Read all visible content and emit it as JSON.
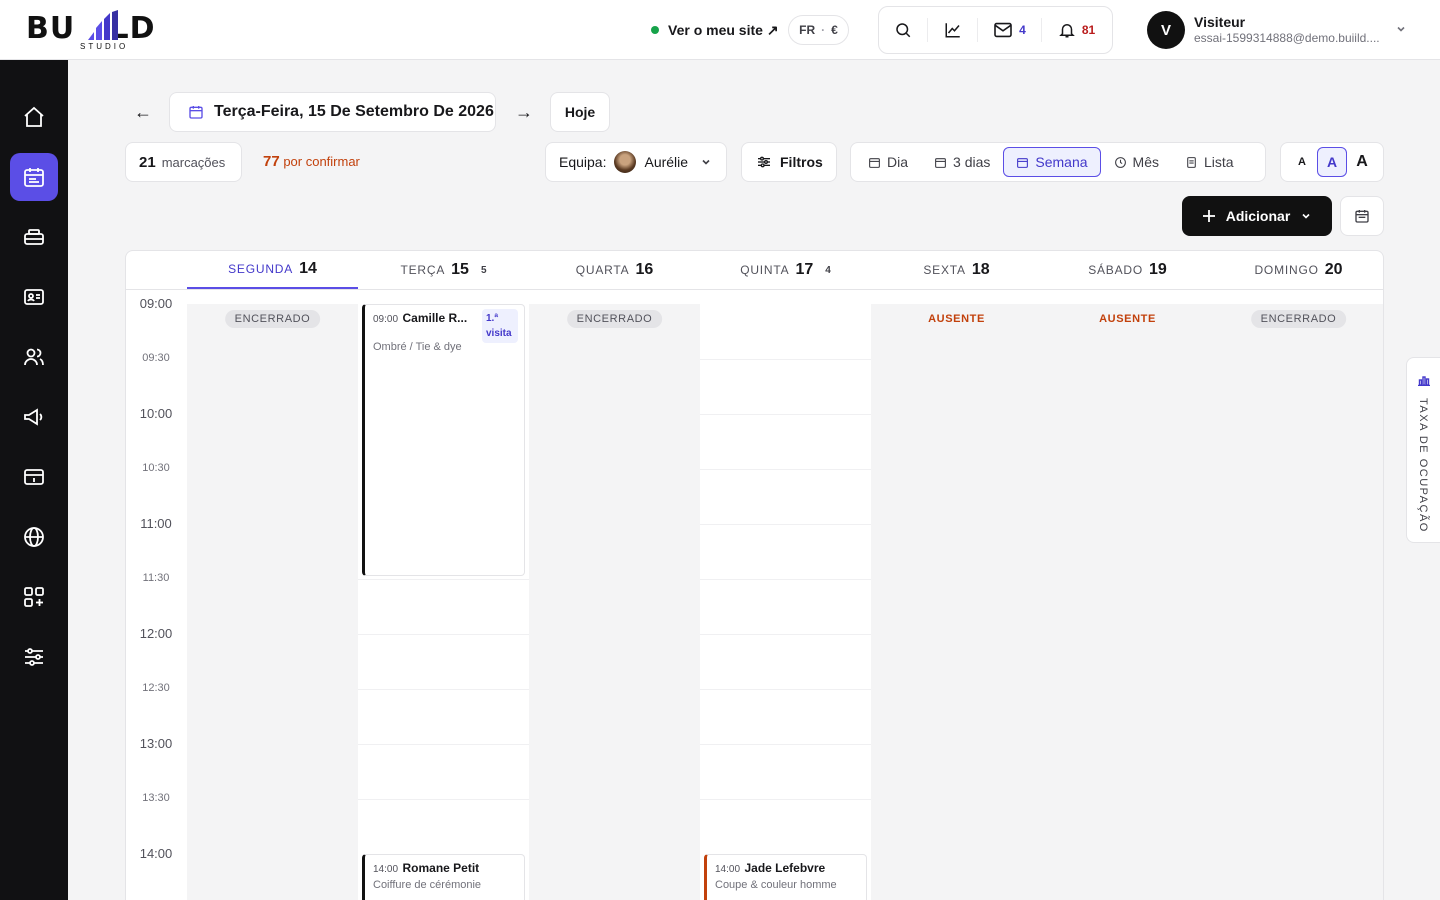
{
  "header": {
    "logo": {
      "word": "BU   LD",
      "sub": "STUDIO"
    },
    "site_link": "Ver o meu site ↗",
    "lang": "FR",
    "currency": "€",
    "mail_count": "4",
    "notif_count": "81",
    "user": {
      "initial": "V",
      "name": "Visiteur",
      "email": "essai-1599314888@demo.buiild...."
    }
  },
  "sidebar": {
    "items": [
      "home-icon",
      "calendar-icon",
      "cash-register-icon",
      "id-card-icon",
      "users-icon",
      "megaphone-icon",
      "payment-card-icon",
      "globe-icon",
      "apps-icon",
      "settings-sliders-icon"
    ],
    "active": "calendar-icon",
    "accent": "#5b4ee6"
  },
  "toolbar": {
    "prev_arrow": "←",
    "next_arrow": "→",
    "date_label": "Terça-Feira, 15 De Setembro De 2026",
    "today_label": "Hoje",
    "bookings_count": "21",
    "bookings_label": "marcações",
    "pending_count": "77",
    "pending_label": "por confirmar",
    "team_label": "Equipa:",
    "team_member": "Aurélie",
    "filters_label": "Filtros",
    "views": {
      "day": "Dia",
      "three_days": "3 dias",
      "week": "Semana",
      "month": "Mês",
      "list": "Lista"
    },
    "active_view": "week",
    "sizes": [
      "A",
      "A",
      "A"
    ],
    "add_label": "Adicionar"
  },
  "calendar": {
    "days": [
      {
        "name": "SEGUNDA",
        "num": "14",
        "count": "",
        "status": "closed",
        "badge": "ENCERRADO",
        "active": true
      },
      {
        "name": "TERÇA",
        "num": "15",
        "count": "5",
        "status": "open",
        "badge": ""
      },
      {
        "name": "QUARTA",
        "num": "16",
        "count": "",
        "status": "closed",
        "badge": "ENCERRADO"
      },
      {
        "name": "QUINTA",
        "num": "17",
        "count": "4",
        "status": "open",
        "badge": ""
      },
      {
        "name": "SEXTA",
        "num": "18",
        "count": "",
        "status": "absent",
        "badge": "AUSENTE"
      },
      {
        "name": "SÁBADO",
        "num": "19",
        "count": "",
        "status": "absent",
        "badge": "AUSENTE"
      },
      {
        "name": "DOMINGO",
        "num": "20",
        "count": "",
        "status": "closed",
        "badge": "ENCERRADO"
      }
    ],
    "times": [
      "09:00",
      "09:30",
      "10:00",
      "10:30",
      "11:00",
      "11:30",
      "12:00",
      "12:30",
      "13:00",
      "13:30",
      "14:00"
    ],
    "events": [
      {
        "time": "09:00",
        "name": "Camille R...",
        "service": "Ombré / Tie & dye",
        "tag": "1.ª visita",
        "color": "#111111"
      },
      {
        "time": "14:00",
        "name": "Romane Petit",
        "service": "Coiffure de cérémonie",
        "color": "#111111"
      },
      {
        "time": "14:00",
        "name": "Jade Lefebvre",
        "service": "Coupe & couleur homme",
        "color": "#c2410c"
      }
    ]
  },
  "occupancy_tab": {
    "label": "TAXA DE OCUPAÇÃO"
  }
}
